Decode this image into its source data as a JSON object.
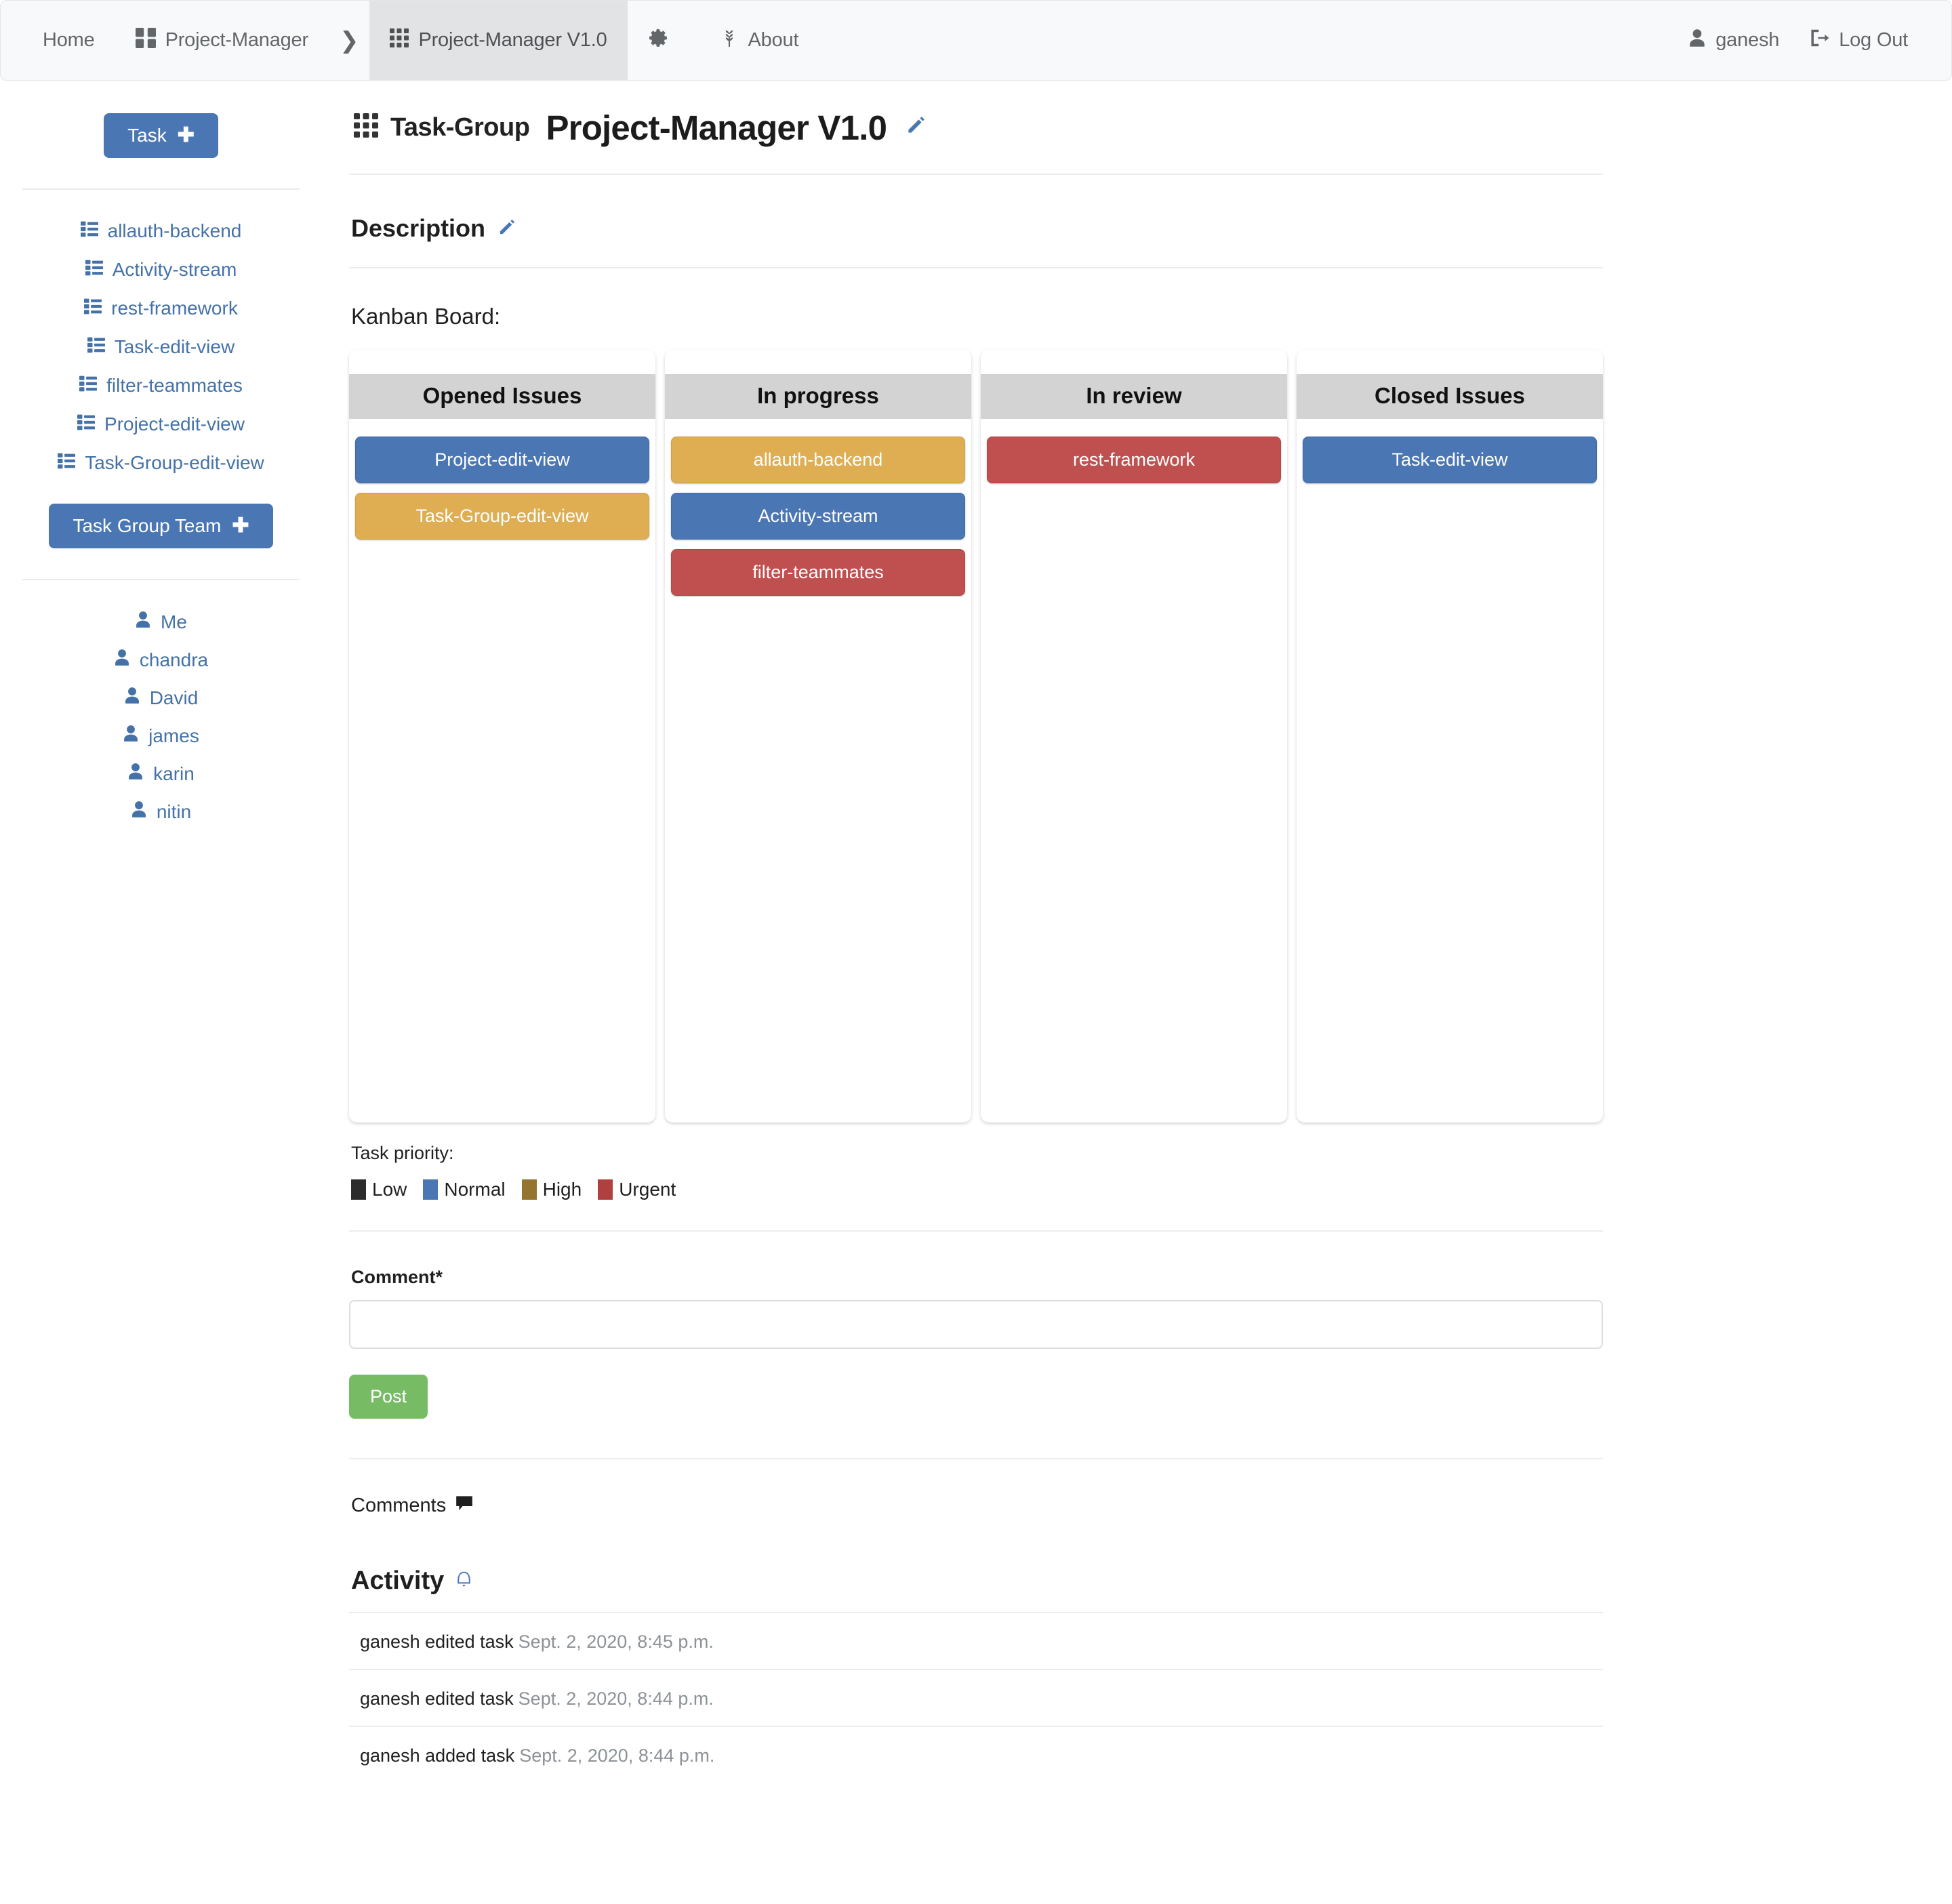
{
  "navbar": {
    "left_items": [
      {
        "label": "Home",
        "icon": null,
        "active": false
      },
      {
        "label": "Project-Manager",
        "icon": "th-large-icon",
        "active": false
      },
      {
        "label": "Project-Manager V1.0",
        "icon": "th-icon",
        "active": true
      },
      {
        "label": "",
        "icon": "gear-icon",
        "active": false
      },
      {
        "label": "About",
        "icon": "seedling-icon",
        "active": false
      }
    ],
    "caret": "❯",
    "user": "ganesh",
    "logout": "Log Out"
  },
  "sidebar": {
    "add_task_button": "Task",
    "add_task_plus": "✚",
    "task_links": [
      "allauth-backend",
      "Activity-stream",
      "rest-framework",
      "Task-edit-view",
      "filter-teammates",
      "Project-edit-view",
      "Task-Group-edit-view"
    ],
    "add_team_button": "Task Group Team",
    "add_team_plus": "✚",
    "team_members": [
      "Me",
      "chandra",
      "David",
      "james",
      "karin",
      "nitin"
    ]
  },
  "main": {
    "title_kicker": "Task-Group",
    "title_main": "Project-Manager V1.0",
    "description_heading": "Description",
    "kanban_label": "Kanban Board:",
    "priority_label": "Task priority:",
    "comment_label": "Comment*",
    "comment_value": "",
    "comment_placeholder": "",
    "post_button": "Post",
    "comments_heading": "Comments",
    "activity_heading": "Activity"
  },
  "kanban": {
    "columns": [
      {
        "title": "Opened Issues",
        "cards": [
          {
            "label": "Project-edit-view",
            "priority": "Normal",
            "color": "#4a77b4"
          },
          {
            "label": "Task-Group-edit-view",
            "priority": "High",
            "color": "#dfad52"
          }
        ]
      },
      {
        "title": "In progress",
        "cards": [
          {
            "label": "allauth-backend",
            "priority": "High",
            "color": "#dfad52"
          },
          {
            "label": "Activity-stream",
            "priority": "Normal",
            "color": "#4a77b4"
          },
          {
            "label": "filter-teammates",
            "priority": "Urgent",
            "color": "#c05050"
          }
        ]
      },
      {
        "title": "In review",
        "cards": [
          {
            "label": "rest-framework",
            "priority": "Urgent",
            "color": "#c05050"
          }
        ]
      },
      {
        "title": "Closed Issues",
        "cards": [
          {
            "label": "Task-edit-view",
            "priority": "Normal",
            "color": "#4a77b4"
          }
        ]
      }
    ]
  },
  "priority_legend": [
    {
      "label": "Low",
      "color": "#2c2c2c"
    },
    {
      "label": "Normal",
      "color": "#4a77b4"
    },
    {
      "label": "High",
      "color": "#94742e"
    },
    {
      "label": "Urgent",
      "color": "#b04040"
    }
  ],
  "activity": [
    {
      "text": "ganesh edited task",
      "when": "Sept. 2, 2020, 8:45 p.m."
    },
    {
      "text": "ganesh edited task",
      "when": "Sept. 2, 2020, 8:44 p.m."
    },
    {
      "text": "ganesh added task",
      "when": "Sept. 2, 2020, 8:44 p.m."
    }
  ]
}
